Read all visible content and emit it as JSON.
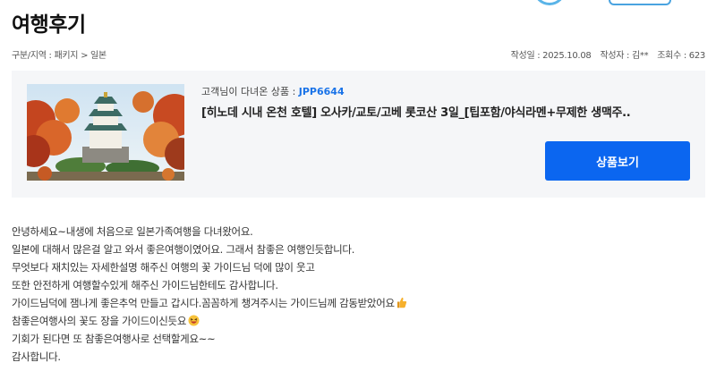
{
  "page": {
    "title": "여행후기"
  },
  "meta": {
    "category": "구분/지역 : 패키지 > 일본",
    "date": "작성일 : 2025.10.08",
    "author": "작성자 : 김**",
    "views": "조회수 : 623"
  },
  "product": {
    "caption_prefix": "고객님이 다녀온 상품 : ",
    "code": "JPP6644",
    "name": "[히노데 시내 온천 호텔] 오사카/교토/고베 롯코산 3일_[팁포함/야식라멘+무제한 생맥주..",
    "view_button": "상품보기",
    "image_icon": "osaka-castle-photo"
  },
  "review": {
    "lines": [
      " 안녕하세요~내생에 처음으로 일본가족여행을 다녀왔어요.",
      "일본에 대해서 많은걸 알고 와서 좋은여행이였어요. 그래서 참좋은 여행인듯합니다.",
      "무엇보다 재치있는 자세한설명 해주신 여행의 꽃 가이드님 덕에 많이 웃고",
      "또한 안전하게 여행할수있게 해주신 가이드님한테도 감사합니다.",
      "가이드님덕에 잼나게 좋은추억 만들고 갑시다.꼼꼼하게 챙겨주시는 가이드님께 감동받았어요",
      "참좋은여행사의 꽃도 장을 가이드이신듯요",
      "기회가 된다면 또 참좋은여행사로 선택할게요~~",
      "감사합니다."
    ],
    "emoji_line5": "thumbs-up-icon",
    "emoji_line6": "laughing-face-icon"
  },
  "colors": {
    "accent": "#0b66f0",
    "code": "#1a73e8",
    "box_bg": "#f5f6f8"
  }
}
